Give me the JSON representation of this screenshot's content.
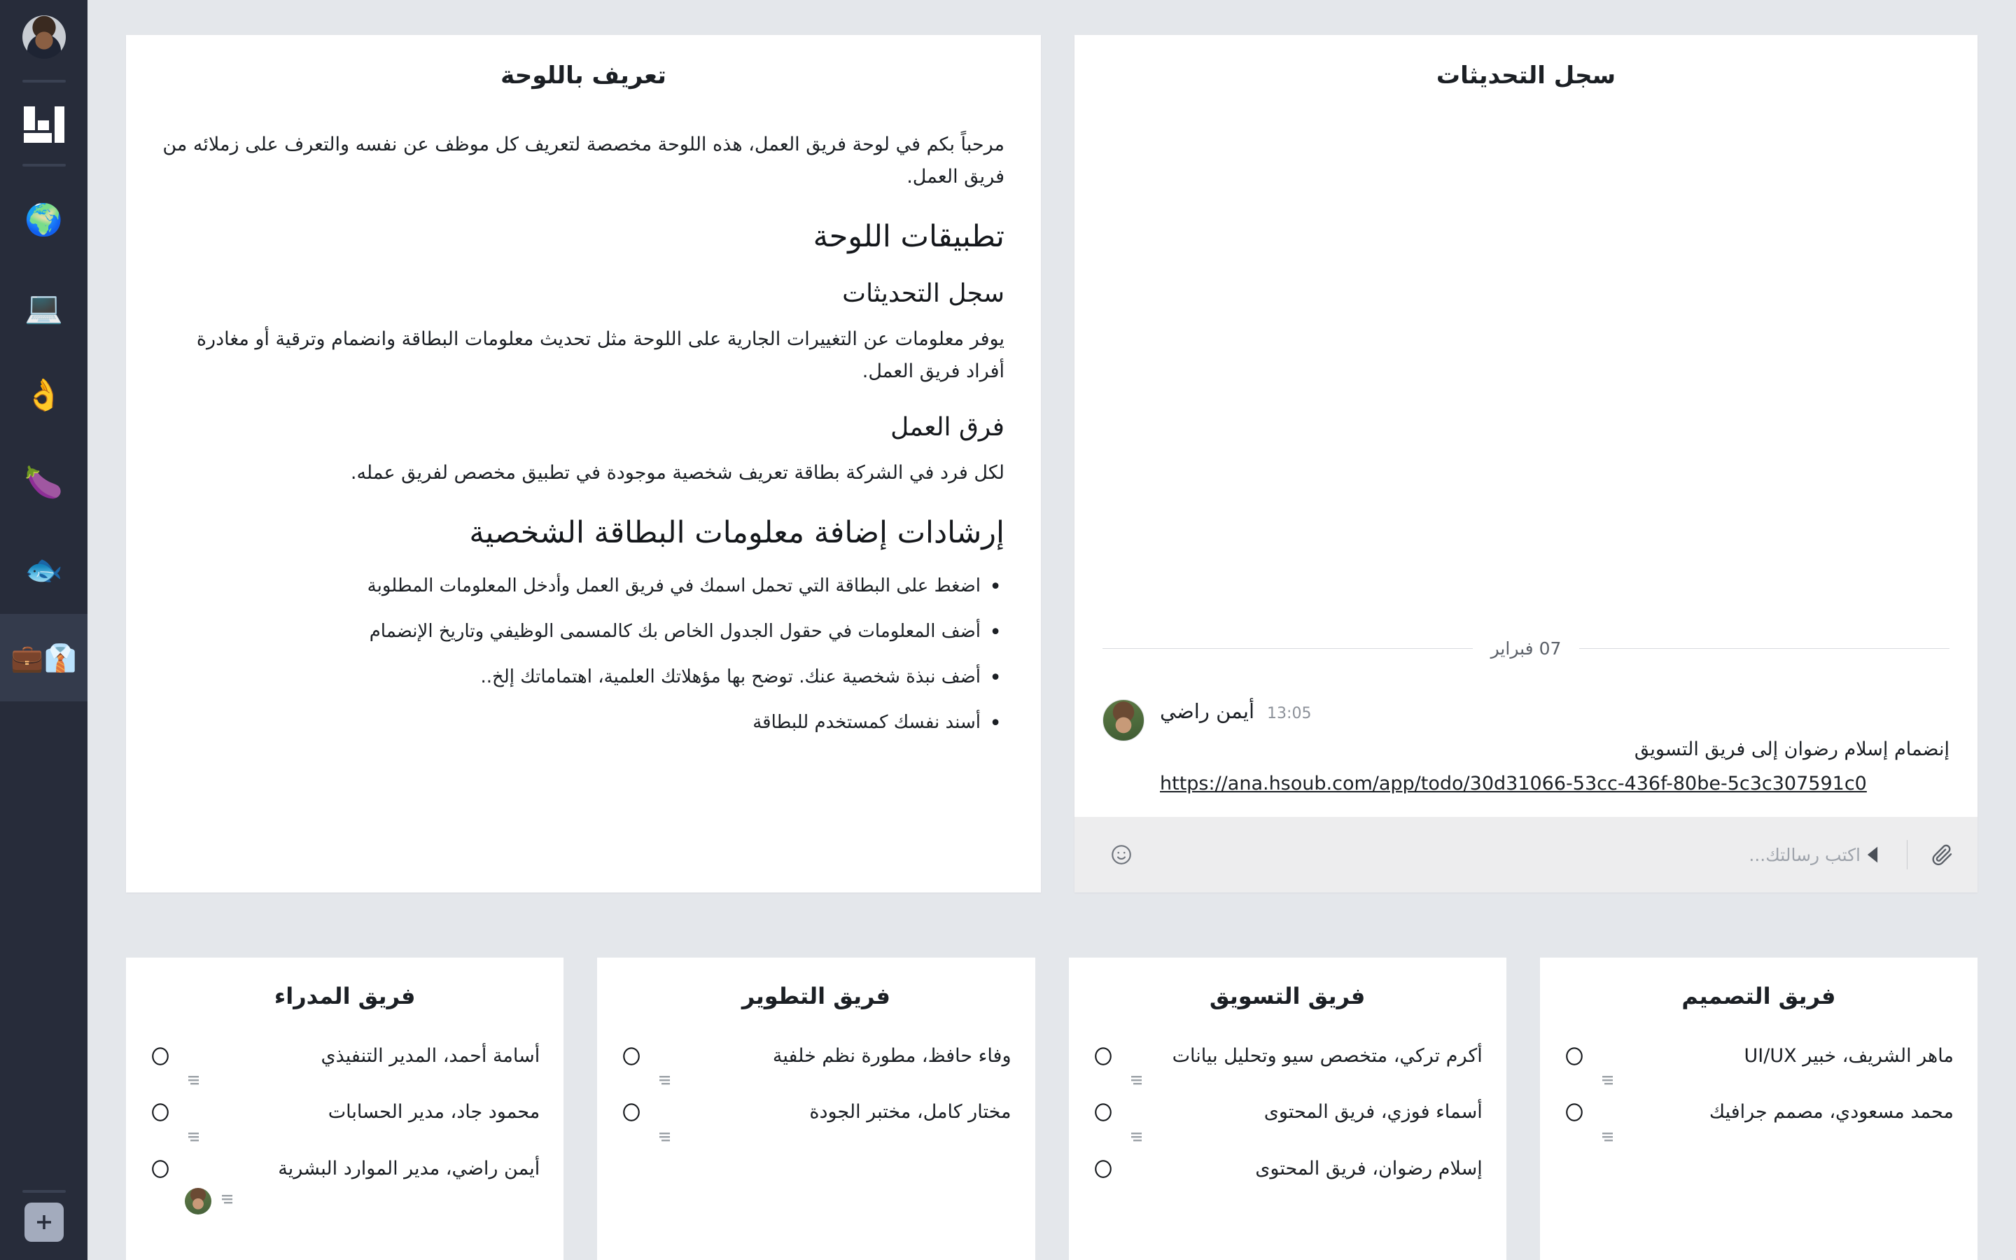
{
  "colors": {
    "page_bg": "#e4e7eb",
    "card_bg": "#ffffff",
    "sidebar_bg": "#272c3a",
    "sidebar_active": "#343b4c",
    "composer_bg": "#ededee",
    "text": "#1b1f24",
    "muted": "#8c9199",
    "add_button": "#a3abbd"
  },
  "updates_card": {
    "title": "سجل التحديثات",
    "date_separator": "07 فبراير",
    "message": {
      "author": "أيمن راضي",
      "time": "13:05",
      "text": "إنضمام إسلام رضوان إلى فريق التسويق",
      "link": "https://ana.hsoub.com/app/todo/30d31066-53cc-436f-80be-5c3c307591c0"
    },
    "composer": {
      "placeholder": "اكتب رسالتك...",
      "emoji_icon": "smiley-icon",
      "attach_icon": "paperclip-icon",
      "send_icon": "send-arrow-icon"
    }
  },
  "intro_card": {
    "title": "تعريف باللوحة",
    "intro_paragraph": "مرحباً بكم في لوحة فريق العمل، هذه اللوحة مخصصة لتعريف كل موظف عن نفسه والتعرف على زملائه من فريق العمل.",
    "section_apps_heading": "تطبيقات اللوحة",
    "subsection_updates_heading": "سجل التحديثات",
    "subsection_updates_text": "يوفر معلومات عن التغييرات الجارية على اللوحة مثل تحديث معلومات البطاقة وانضمام وترقية أو مغادرة أفراد فريق العمل.",
    "subsection_teams_heading": "فرق العمل",
    "subsection_teams_text": "لكل فرد في الشركة بطاقة تعريف شخصية موجودة في تطبيق مخصص لفريق عمله.",
    "guidelines_heading": "إرشادات إضافة معلومات البطاقة الشخصية",
    "guidelines": [
      "اضغط على البطاقة التي تحمل اسمك في فريق العمل وأدخل المعلومات المطلوبة",
      "أضف المعلومات في حقول الجدول الخاص بك كالمسمى الوظيفي وتاريخ الإنضمام",
      "أضف نبذة شخصية عنك. توضح بها مؤهلاتك العلمية، اهتماماتك إلخ..",
      "أسند نفسك كمستخدم للبطاقة"
    ]
  },
  "teams": [
    {
      "title": "فريق التصميم",
      "members": [
        {
          "name": "ماهر الشريف، خبير UI/UX",
          "has_photo": false
        },
        {
          "name": "محمد مسعودي، مصمم جرافيك",
          "has_photo": false
        }
      ]
    },
    {
      "title": "فريق التسويق",
      "members": [
        {
          "name": "أكرم تركي، متخصص سيو وتحليل بيانات",
          "has_photo": false
        },
        {
          "name": "أسماء فوزي، فريق المحتوى",
          "has_photo": false
        },
        {
          "name": "إسلام رضوان، فريق المحتوى",
          "has_photo": false
        }
      ]
    },
    {
      "title": "فريق التطوير",
      "members": [
        {
          "name": "وفاء حافظ، مطورة نظم خلفية",
          "has_photo": false
        },
        {
          "name": "مختار كامل، مختبر الجودة",
          "has_photo": false
        }
      ]
    },
    {
      "title": "فريق المدراء",
      "members": [
        {
          "name": "أسامة أحمد، المدير التنفيذي",
          "has_photo": false
        },
        {
          "name": "محمود جاد، مدير الحسابات",
          "has_photo": false
        },
        {
          "name": "أيمن راضي، مدير الموارد البشرية",
          "has_photo": true
        }
      ]
    }
  ],
  "sidebar": {
    "avatar": "user-avatar",
    "logo": "app-logo-icon",
    "boards": [
      {
        "icon_name": "globe-icon",
        "glyph": "🌍",
        "active": false
      },
      {
        "icon_name": "laptop-icon",
        "glyph": "💻",
        "active": false
      },
      {
        "icon_name": "ok-hand-icon",
        "glyph": "👌",
        "active": false
      },
      {
        "icon_name": "eggplant-icon",
        "glyph": "🍆",
        "active": false
      },
      {
        "icon_name": "fish-icon",
        "glyph": "🐟",
        "active": false
      },
      {
        "icon_name": "briefcase-necktie-icon",
        "glyph": "👔💼",
        "active": true
      }
    ],
    "add_label": "+"
  }
}
